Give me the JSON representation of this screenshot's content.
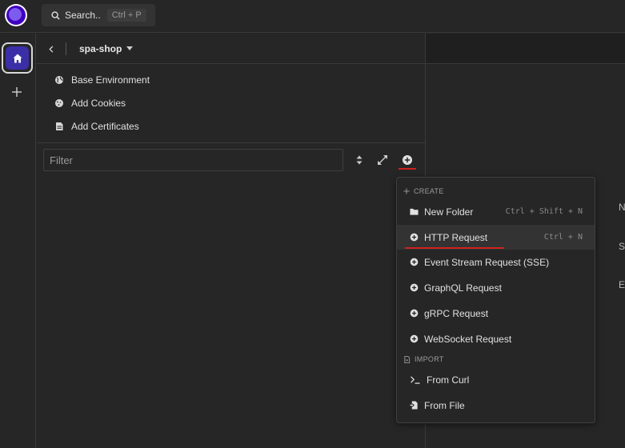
{
  "search": {
    "label": "Search..",
    "shortcut": "Ctrl + P"
  },
  "project": {
    "name": "spa-shop"
  },
  "environment_items": [
    {
      "label": "Base Environment",
      "icon": "globe-icon"
    },
    {
      "label": "Add Cookies",
      "icon": "cookie-icon"
    },
    {
      "label": "Add Certificates",
      "icon": "certificate-icon"
    }
  ],
  "filter": {
    "placeholder": "Filter"
  },
  "dropdown": {
    "create_label": "CREATE",
    "import_label": "IMPORT",
    "items": [
      {
        "label": "New Folder",
        "shortcut": "Ctrl + Shift + N",
        "icon": "folder-icon"
      },
      {
        "label": "HTTP Request",
        "shortcut": "Ctrl + N",
        "icon": "plus-circle-icon"
      },
      {
        "label": "Event Stream Request (SSE)",
        "icon": "plus-circle-icon"
      },
      {
        "label": "GraphQL Request",
        "icon": "plus-circle-icon"
      },
      {
        "label": "gRPC Request",
        "icon": "plus-circle-icon"
      },
      {
        "label": "WebSocket Request",
        "icon": "plus-circle-icon"
      }
    ],
    "import_items": [
      {
        "label": "From Curl",
        "icon": "terminal-icon"
      },
      {
        "label": "From File",
        "icon": "file-import-icon"
      }
    ]
  },
  "edge_letters": [
    "N",
    "S",
    "E"
  ],
  "colors": {
    "accent": "#4000bf",
    "highlight": "#d01f1f",
    "active_row": "#333333"
  }
}
